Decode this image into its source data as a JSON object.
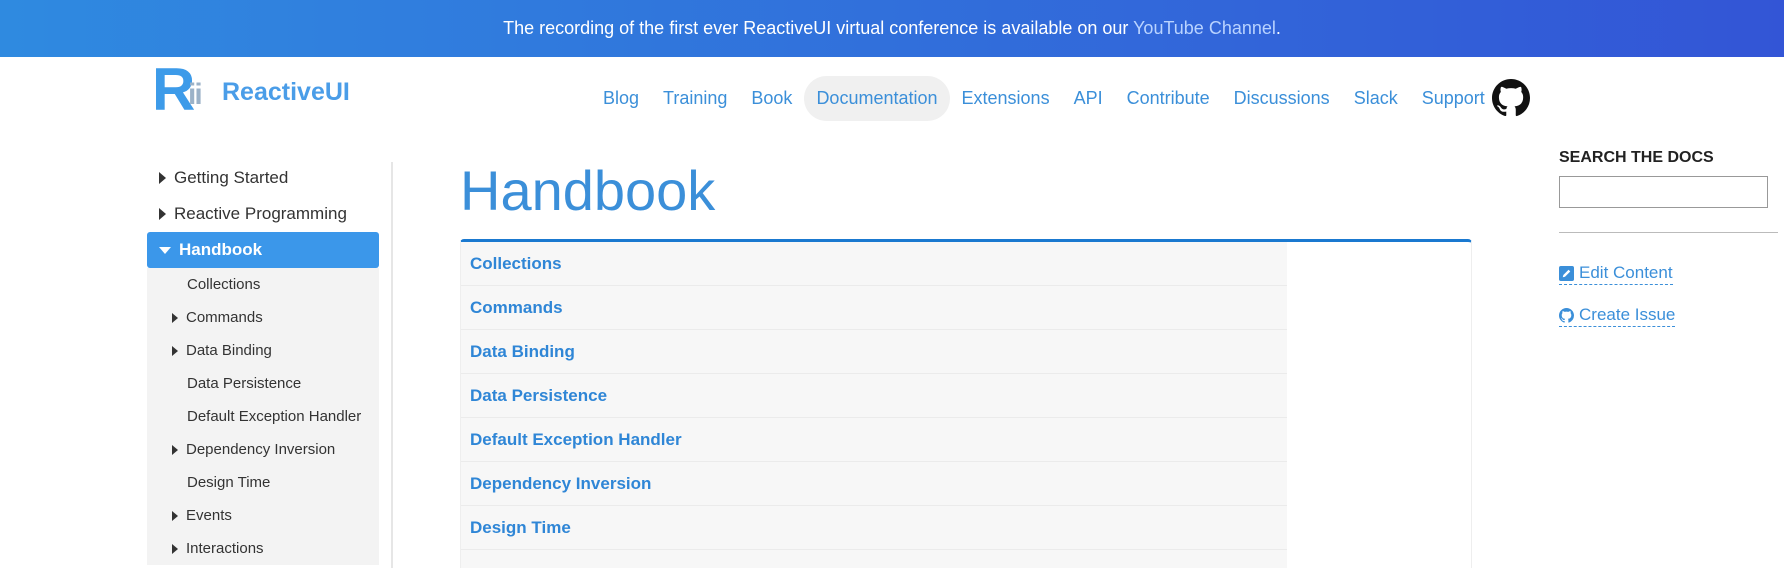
{
  "banner": {
    "text": "The recording of the first ever ReactiveUI virtual conference is available on our ",
    "link": "YouTube Channel",
    "suffix": "."
  },
  "brand": {
    "mark": "R",
    "mark_suffix": "ii",
    "name": "ReactiveUI"
  },
  "nav": {
    "items": [
      "Blog",
      "Training",
      "Book",
      "Documentation",
      "Extensions",
      "API",
      "Contribute",
      "Discussions",
      "Slack",
      "Support"
    ],
    "active": "Documentation",
    "github_icon": "github-icon"
  },
  "sidebar": {
    "top_items": [
      {
        "label": "Getting Started",
        "expandable": true
      },
      {
        "label": "Reactive Programming",
        "expandable": true
      }
    ],
    "active": {
      "label": "Handbook",
      "expanded": true
    },
    "sub_items": [
      {
        "label": "Collections",
        "expandable": false
      },
      {
        "label": "Commands",
        "expandable": true
      },
      {
        "label": "Data Binding",
        "expandable": true
      },
      {
        "label": "Data Persistence",
        "expandable": false
      },
      {
        "label": "Default Exception Handler",
        "expandable": false
      },
      {
        "label": "Dependency Inversion",
        "expandable": true
      },
      {
        "label": "Design Time",
        "expandable": false
      },
      {
        "label": "Events",
        "expandable": true
      },
      {
        "label": "Interactions",
        "expandable": true
      }
    ]
  },
  "main": {
    "title": "Handbook",
    "toc": [
      "Collections",
      "Commands",
      "Data Binding",
      "Data Persistence",
      "Default Exception Handler",
      "Dependency Inversion",
      "Design Time"
    ]
  },
  "right": {
    "search_title": "SEARCH THE DOCS",
    "search_placeholder": "",
    "edit_label": "Edit Content",
    "issue_label": "Create Issue"
  },
  "colors": {
    "accent": "#3b8fd9",
    "banner_start": "#2f8ae0",
    "banner_end": "#3355d6",
    "active_sidebar": "#3b97ea"
  }
}
